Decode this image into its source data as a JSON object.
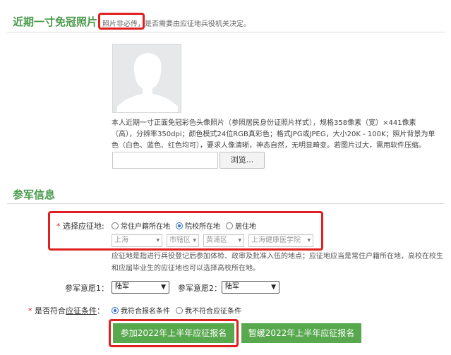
{
  "photo_section": {
    "title": "近期一寸免冠照片",
    "hint_highlight": "照片非必传",
    "hint_rest": "，是否需要由应征地兵役机关决定。",
    "description": "本人近期一寸正面免冠彩色头像照片（参照居民身份证照片样式），规格358像素（宽）×441像素（高），分辨率350dpi；颜色模式24位RGB真彩色；格式JPG或JPEG，大小20K - 100K；照片背景为单色（白色、蓝色、红色均可），要求人像清晰，神态自然，无明显畸变。若图片过大，需用软件压缩。",
    "file_value": "",
    "browse_label": "浏览..."
  },
  "enlist_section": {
    "title": "参军信息",
    "location_label": "选择应征地:",
    "location_options": [
      "常住户籍所在地",
      "院校所在地",
      "居住地"
    ],
    "location_selected": 1,
    "region_selects": [
      "上海",
      "市辖区",
      "黄浦区",
      "上海健康医学院"
    ],
    "location_note": "应征地是指进行兵役登记后参加体检、政审及批准入伍的地点；应征地应当是常住户籍所在地，高校在校生和应届毕业生的应征地也可以选择高校所在地。",
    "wish1_label": "参军意愿1：",
    "wish1_value": "陆军",
    "wish2_label": "参军意愿2：",
    "wish2_value": "陆军",
    "eligible_label_prefix": "是否符合",
    "eligible_label_link": "应征条件",
    "eligible_label_suffix": "：",
    "eligible_options": [
      "我符合报名条件",
      "我不符合应征条件"
    ],
    "eligible_selected": 0
  },
  "actions": {
    "primary_label": "参加2022年上半年应征报名",
    "secondary_label": "暂缓2022年上半年应征报名"
  },
  "colors": {
    "accent": "#58a84e",
    "title": "#4a9a4a",
    "highlight": "#e02020",
    "radio": "#2c6fd6"
  }
}
